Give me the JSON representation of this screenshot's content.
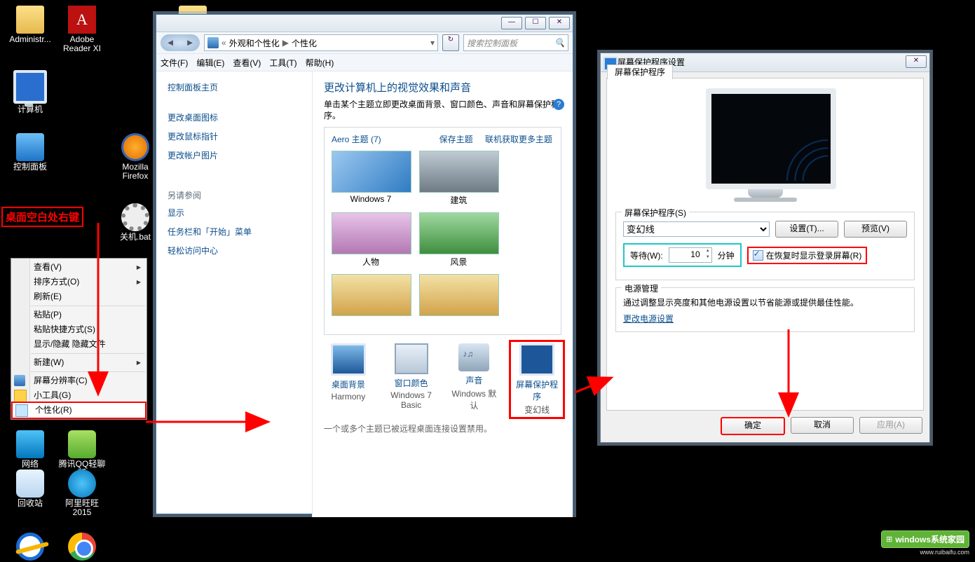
{
  "desktop": {
    "icons": [
      {
        "name": "Administr..."
      },
      {
        "name": "Adobe Reader XI"
      },
      {
        "name": "计算机"
      },
      {
        "name": "控制面板"
      },
      {
        "name": "Mozilla Firefox"
      },
      {
        "name": "关机.bat"
      },
      {
        "name": "网络"
      },
      {
        "name": "腾讯QQ轻聊版"
      },
      {
        "name": "回收站"
      },
      {
        "name": "阿里旺旺2015"
      }
    ]
  },
  "red_label": "桌面空白处右键",
  "context_menu": {
    "items": [
      {
        "label": "查看(V)",
        "sub": true
      },
      {
        "label": "排序方式(O)",
        "sub": true
      },
      {
        "label": "刷新(E)"
      },
      {
        "sep": true
      },
      {
        "label": "粘贴(P)"
      },
      {
        "label": "粘贴快捷方式(S)"
      },
      {
        "label": "显示/隐藏 隐藏文件"
      },
      {
        "sep": true
      },
      {
        "label": "新建(W)",
        "sub": true
      },
      {
        "sep": true
      },
      {
        "label": "屏幕分辨率(C)",
        "icon": "mi-monitor"
      },
      {
        "label": "小工具(G)",
        "icon": "mi-gadget"
      },
      {
        "label": "个性化(R)",
        "icon": "mi-pers",
        "selected": true
      }
    ]
  },
  "explorer": {
    "title_buttons": [
      "—",
      "☐",
      "✕"
    ],
    "refresh": "↻",
    "crumbs": {
      "sep": "«",
      "p1": "外观和个性化",
      "arrow": "▶",
      "p2": "个性化",
      "drop": "▾"
    },
    "search_placeholder": "搜索控制面板",
    "menubar": [
      "文件(F)",
      "编辑(E)",
      "查看(V)",
      "工具(T)",
      "帮助(H)"
    ],
    "side": {
      "home": "控制面板主页",
      "links": [
        "更改桌面图标",
        "更改鼠标指针",
        "更改帐户图片"
      ],
      "seealso_head": "另请参阅",
      "seealso": [
        "显示",
        "任务栏和「开始」菜单",
        "轻松访问中心"
      ]
    },
    "content": {
      "h1": "更改计算机上的视觉效果和声音",
      "sub": "单击某个主题立即更改桌面背景、窗口颜色、声音和屏幕保护程序。",
      "save_theme": "保存主题",
      "more_themes": "联机获取更多主题",
      "aero_head": "Aero 主题 (7)",
      "tiles": [
        "Windows 7",
        "建筑",
        "人物",
        "风景"
      ],
      "bottom": [
        {
          "l1": "桌面背景",
          "l2": "Harmony"
        },
        {
          "l1": "窗口颜色",
          "l2": "Windows 7 Basic"
        },
        {
          "l1": "声音",
          "l2": "Windows 默认"
        },
        {
          "l1": "屏幕保护程序",
          "l2": "变幻线",
          "sel": true
        }
      ],
      "footnote": "一个或多个主题已被远程桌面连接设置禁用。"
    }
  },
  "ss_dialog": {
    "title": "屏幕保护程序设置",
    "close": "✕",
    "tab": "屏幕保护程序",
    "group1": "屏幕保护程序(S)",
    "dropdown": "变幻线",
    "settings_btn": "设置(T)...",
    "preview_btn": "预览(V)",
    "wait_label": "等待(W):",
    "wait_value": "10",
    "wait_unit": "分钟",
    "resume_chk": "在恢复时显示登录屏幕(R)",
    "group2": "电源管理",
    "power_text": "通过调整显示亮度和其他电源设置以节省能源或提供最佳性能。",
    "power_link": "更改电源设置",
    "ok": "确定",
    "cancel": "取消",
    "apply": "应用(A)"
  },
  "watermark": {
    "brand": "windows系统家园",
    "sub": "www.ruibaifu.com",
    "flag": "⊞"
  }
}
